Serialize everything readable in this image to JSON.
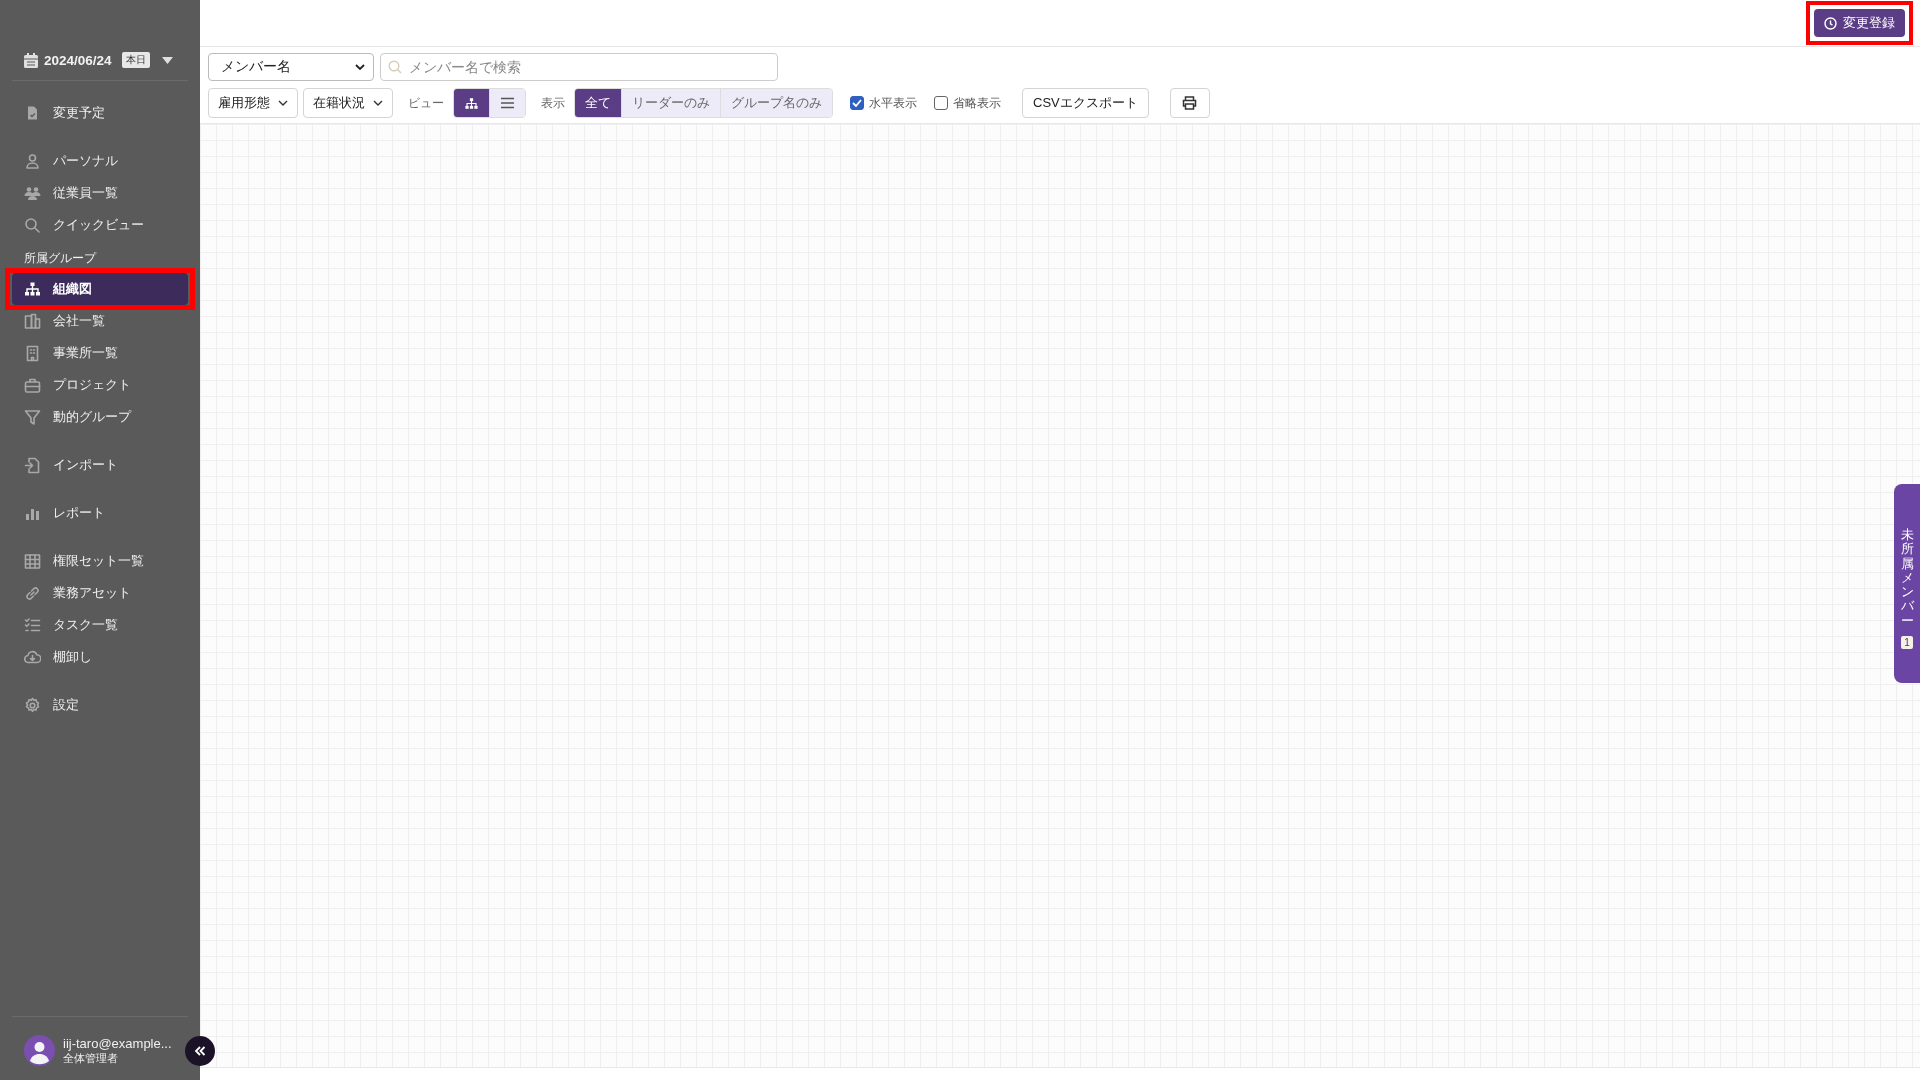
{
  "date_picker": {
    "date": "2024/06/24",
    "badge": "本日"
  },
  "sidebar": {
    "sections": [
      {
        "items": [
          {
            "label": "変更予定",
            "selected": false,
            "highlighted": false
          }
        ]
      },
      {
        "items": [
          {
            "label": "パーソナル",
            "selected": false,
            "highlighted": false
          },
          {
            "label": "従業員一覧",
            "selected": false,
            "highlighted": false
          },
          {
            "label": "クイックビュー",
            "selected": false,
            "highlighted": false
          }
        ]
      },
      {
        "label": "所属グループ",
        "items": [
          {
            "label": "組織図",
            "selected": true,
            "highlighted": true
          },
          {
            "label": "会社一覧",
            "selected": false,
            "highlighted": false
          },
          {
            "label": "事業所一覧",
            "selected": false,
            "highlighted": false
          },
          {
            "label": "プロジェクト",
            "selected": false,
            "highlighted": false
          },
          {
            "label": "動的グループ",
            "selected": false,
            "highlighted": false
          }
        ]
      },
      {
        "items": [
          {
            "label": "インポート",
            "selected": false,
            "highlighted": false
          }
        ]
      },
      {
        "items": [
          {
            "label": "レポート",
            "selected": false,
            "highlighted": false
          }
        ]
      },
      {
        "items": [
          {
            "label": "権限セット一覧",
            "selected": false,
            "highlighted": false
          },
          {
            "label": "業務アセット",
            "selected": false,
            "highlighted": false
          },
          {
            "label": "タスク一覧",
            "selected": false,
            "highlighted": false
          },
          {
            "label": "棚卸し",
            "selected": false,
            "highlighted": false
          }
        ]
      },
      {
        "items": [
          {
            "label": "設定",
            "selected": false,
            "highlighted": false
          }
        ]
      }
    ]
  },
  "user": {
    "email": "iij-taro@example...",
    "role": "全体管理者"
  },
  "register_button": {
    "label": "変更登録",
    "highlighted": true
  },
  "search": {
    "field_select": "メンバー名",
    "placeholder": "メンバー名で検索"
  },
  "filters": [
    {
      "label": "雇用形態"
    },
    {
      "label": "在籍状況"
    }
  ],
  "view": {
    "label": "ビュー",
    "options": [
      {
        "kind": "tree",
        "selected": true
      },
      {
        "kind": "list",
        "selected": false
      }
    ]
  },
  "display": {
    "label": "表示",
    "options": [
      {
        "label": "全て",
        "selected": true
      },
      {
        "label": "リーダーのみ",
        "selected": false
      },
      {
        "label": "グループ名のみ",
        "selected": false
      }
    ]
  },
  "checkboxes": [
    {
      "label": "水平表示",
      "checked": true
    },
    {
      "label": "省略表示",
      "checked": false
    }
  ],
  "export_button": "CSVエクスポート",
  "side_tab": {
    "label": "未所属メンバー",
    "count": "1"
  }
}
